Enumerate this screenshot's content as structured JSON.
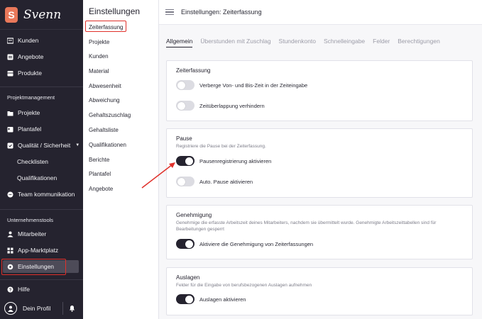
{
  "brand": {
    "logo_letter": "S",
    "name": "Svenn"
  },
  "sidebar": {
    "items": [
      {
        "label": "Kunden",
        "icon": "users-icon"
      },
      {
        "label": "Angebote",
        "icon": "quote-icon"
      },
      {
        "label": "Produkte",
        "icon": "box-icon"
      }
    ],
    "section_projekt": "Projektmanagement",
    "projekt_items": [
      {
        "label": "Projekte",
        "icon": "folder-icon"
      },
      {
        "label": "Plantafel",
        "icon": "calendar-icon"
      },
      {
        "label": "Qualität / Sicherheit",
        "icon": "shield-icon"
      },
      {
        "label": "Checklisten"
      },
      {
        "label": "Qualifikationen"
      },
      {
        "label": "Team kommunikation",
        "icon": "chat-icon"
      }
    ],
    "section_unternehmen": "Unternehmenstools",
    "unternehmen_items": [
      {
        "label": "Mitarbeiter",
        "icon": "person-icon"
      },
      {
        "label": "App-Marktplatz",
        "icon": "grid-icon"
      },
      {
        "label": "Einstellungen",
        "icon": "gear-icon"
      }
    ],
    "help": "Hilfe",
    "profile": "Dein Profil"
  },
  "submenu": {
    "title": "Einstellungen",
    "items": [
      "Zeiterfassung",
      "Projekte",
      "Kunden",
      "Material",
      "Abwesenheit",
      "Abweichung",
      "Gehaltszuschlag",
      "Gehaltsliste",
      "Qualifikationen",
      "Berichte",
      "Plantafel",
      "Angebote"
    ]
  },
  "topbar": {
    "title": "Einstellungen: Zeiterfassung"
  },
  "tabs": [
    "Allgemein",
    "Überstunden mit Zuschlag",
    "Stundenkonto",
    "Schnelleingabe",
    "Felder",
    "Berechtigungen"
  ],
  "cards": {
    "zeiterfassung": {
      "title": "Zeiterfassung",
      "toggles": [
        {
          "label": "Verberge Von- und Bis-Zeit in der Zeiteingabe",
          "on": false
        },
        {
          "label": "Zeitüberlappung verhindern",
          "on": false
        }
      ]
    },
    "pause": {
      "title": "Pause",
      "desc": "Registriere die Pause bei der Zeiterfassung.",
      "toggles": [
        {
          "label": "Pausenregistrierung aktivieren",
          "on": true
        },
        {
          "label": "Auto. Pause aktivieren",
          "on": false
        }
      ]
    },
    "genehmigung": {
      "title": "Genehmigung",
      "desc": "Genehmige die erfasste Arbeitszeit deines Mitarbeiters, nachdem sie übermittelt wurde. Genehmigte Arbeitszeittabellen sind für Bearbeitungen gesperrt",
      "toggles": [
        {
          "label": "Aktiviere die Genehmigung von Zeiterfassungen",
          "on": true
        }
      ]
    },
    "auslagen": {
      "title": "Auslagen",
      "desc": "Felder für die Eingabe von berufsbezogenen Auslagen aufnehmen",
      "toggles": [
        {
          "label": "Auslagen aktivieren",
          "on": true
        }
      ]
    }
  },
  "colors": {
    "sidebar_bg": "#25232f",
    "accent": "#e9785a",
    "highlight": "#e0302a",
    "toggle_on": "#25232f",
    "toggle_off": "#dcdce2"
  }
}
